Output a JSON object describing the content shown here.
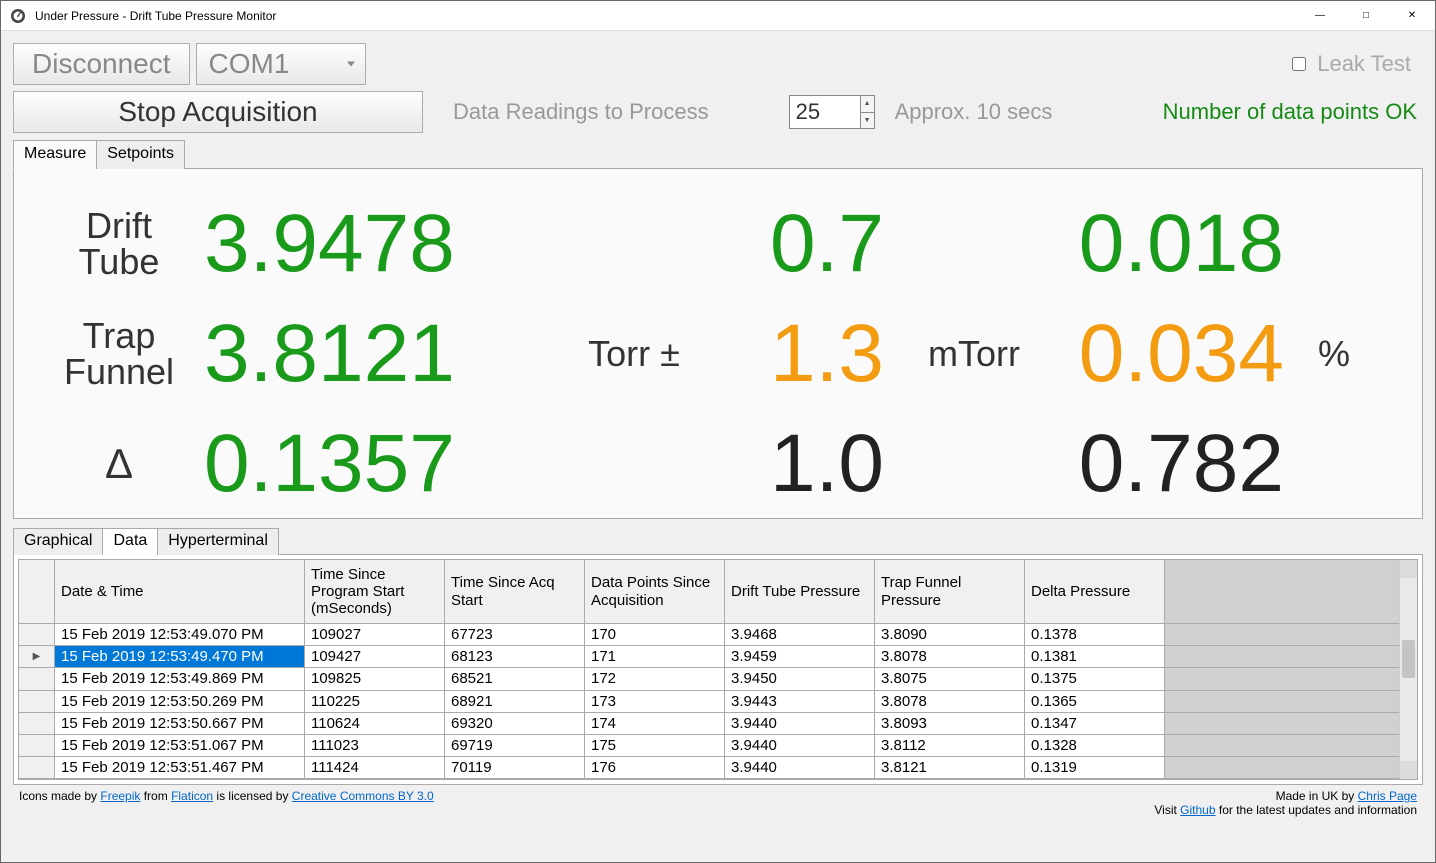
{
  "window": {
    "title": "Under Pressure - Drift Tube Pressure Monitor"
  },
  "toolbar": {
    "disconnect": "Disconnect",
    "com_port": "COM1",
    "leak_test": "Leak Test",
    "stop_acq": "Stop Acquisition",
    "readings_label": "Data Readings to Process",
    "readings_value": "25",
    "approx": "Approx. 10 secs",
    "status": "Number of data points OK"
  },
  "tabs_top": {
    "measure": "Measure",
    "setpoints": "Setpoints"
  },
  "measure": {
    "labels": {
      "drift_tube": "Drift Tube",
      "trap_funnel": "Trap Funnel",
      "delta": "Δ",
      "torr_pm": "Torr ±",
      "mtorr": "mTorr",
      "pct": "%"
    },
    "drift_tube": {
      "torr": "3.9478",
      "pm": "0.7",
      "pct": "0.018"
    },
    "trap_funnel": {
      "torr": "3.8121",
      "pm": "1.3",
      "pct": "0.034"
    },
    "delta": {
      "torr": "0.1357",
      "pm": "1.0",
      "pct": "0.782"
    }
  },
  "tabs_bottom": {
    "graphical": "Graphical",
    "data": "Data",
    "hyperterminal": "Hyperterminal"
  },
  "grid": {
    "headers": [
      "Date & Time",
      "Time Since Program Start (mSeconds)",
      "Time Since Acq Start",
      "Data Points Since Acquisition",
      "Drift Tube Pressure",
      "Trap Funnel Pressure",
      "Delta Pressure"
    ],
    "rows": [
      {
        "dt": "15 Feb 2019 12:53:49.070 PM",
        "ps": "109027",
        "as": "67723",
        "dp": "170",
        "dtp": "3.9468",
        "tfp": "3.8090",
        "del": "0.1378",
        "sel": false,
        "cur": false
      },
      {
        "dt": "15 Feb 2019 12:53:49.470 PM",
        "ps": "109427",
        "as": "68123",
        "dp": "171",
        "dtp": "3.9459",
        "tfp": "3.8078",
        "del": "0.1381",
        "sel": true,
        "cur": true
      },
      {
        "dt": "15 Feb 2019 12:53:49.869 PM",
        "ps": "109825",
        "as": "68521",
        "dp": "172",
        "dtp": "3.9450",
        "tfp": "3.8075",
        "del": "0.1375",
        "sel": false,
        "cur": false
      },
      {
        "dt": "15 Feb 2019 12:53:50.269 PM",
        "ps": "110225",
        "as": "68921",
        "dp": "173",
        "dtp": "3.9443",
        "tfp": "3.8078",
        "del": "0.1365",
        "sel": false,
        "cur": false
      },
      {
        "dt": "15 Feb 2019 12:53:50.667 PM",
        "ps": "110624",
        "as": "69320",
        "dp": "174",
        "dtp": "3.9440",
        "tfp": "3.8093",
        "del": "0.1347",
        "sel": false,
        "cur": false
      },
      {
        "dt": "15 Feb 2019 12:53:51.067 PM",
        "ps": "111023",
        "as": "69719",
        "dp": "175",
        "dtp": "3.9440",
        "tfp": "3.8112",
        "del": "0.1328",
        "sel": false,
        "cur": false
      },
      {
        "dt": "15 Feb 2019 12:53:51.467 PM",
        "ps": "111424",
        "as": "70119",
        "dp": "176",
        "dtp": "3.9440",
        "tfp": "3.8121",
        "del": "0.1319",
        "sel": false,
        "cur": false
      }
    ]
  },
  "footer": {
    "left_pre": "Icons made by ",
    "freepik": "Freepik",
    "mid1": " from ",
    "flaticon": "Flaticon",
    "mid2": " is licensed by ",
    "cc": "Creative Commons BY 3.0",
    "right_pre": "Made in UK by ",
    "author": "Chris Page",
    "line2_pre": "Visit ",
    "github": "Github",
    "line2_post": " for the latest updates and information"
  }
}
